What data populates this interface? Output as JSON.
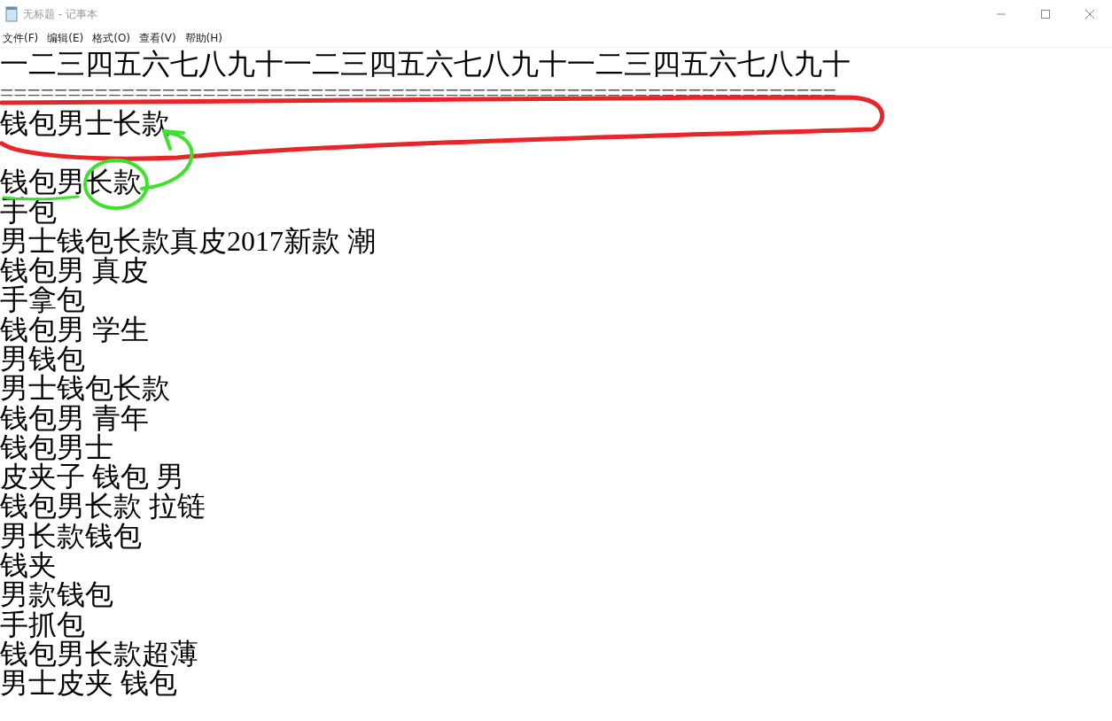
{
  "window": {
    "title": "无标题 - 记事本"
  },
  "menu": [
    "文件(F)",
    "编辑(E)",
    "格式(O)",
    "查看(V)",
    "帮助(H)"
  ],
  "lines": [
    {
      "kind": "text",
      "text": "一二三四五六七八九十一二三四五六七八九十一二三四五六七八九十"
    },
    {
      "kind": "separator",
      "text": "=============================================================="
    },
    {
      "kind": "text",
      "text": "钱包男士长款"
    },
    {
      "kind": "blank"
    },
    {
      "kind": "text",
      "text": "钱包男长款"
    },
    {
      "kind": "text",
      "text": "手包"
    },
    {
      "kind": "text",
      "text": "男士钱包长款真皮2017新款 潮"
    },
    {
      "kind": "text",
      "text": "钱包男 真皮"
    },
    {
      "kind": "text",
      "text": "手拿包"
    },
    {
      "kind": "text",
      "text": "钱包男 学生"
    },
    {
      "kind": "text",
      "text": "男钱包"
    },
    {
      "kind": "text",
      "text": "男士钱包长款"
    },
    {
      "kind": "text",
      "text": "钱包男 青年"
    },
    {
      "kind": "text",
      "text": "钱包男士"
    },
    {
      "kind": "text",
      "text": "皮夹子 钱包 男"
    },
    {
      "kind": "text",
      "text": "钱包男长款 拉链"
    },
    {
      "kind": "text",
      "text": "男长款钱包"
    },
    {
      "kind": "text",
      "text": "钱夹"
    },
    {
      "kind": "text",
      "text": "男款钱包"
    },
    {
      "kind": "text",
      "text": "手抓包"
    },
    {
      "kind": "text",
      "text": "钱包男长款超薄"
    },
    {
      "kind": "text",
      "text": "男士皮夹 钱包"
    }
  ]
}
